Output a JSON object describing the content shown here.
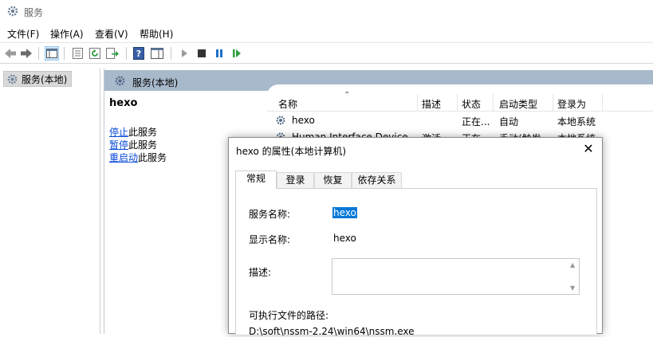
{
  "window": {
    "title": "服务"
  },
  "menu": [
    "文件(F)",
    "操作(A)",
    "查看(V)",
    "帮助(H)"
  ],
  "toolbar": {
    "icons": [
      "back-arrow-icon",
      "forward-arrow-icon",
      "console-tree-icon",
      "properties-sheet-icon",
      "refresh-icon",
      "export-list-icon",
      "help-icon",
      "action-pane-icon",
      "start-service-icon",
      "stop-service-icon",
      "pause-service-icon",
      "restart-service-icon"
    ]
  },
  "tree": {
    "item": "服务(本地)"
  },
  "main": {
    "header": "服务(本地)",
    "service_name": "hexo",
    "actions": [
      {
        "link": "停止",
        "rest": "此服务"
      },
      {
        "link": "暂停",
        "rest": "此服务"
      },
      {
        "link": "重启动",
        "rest": "此服务"
      }
    ]
  },
  "list": {
    "columns": [
      "名称",
      "描述",
      "状态",
      "启动类型",
      "登录为"
    ],
    "rows": [
      {
        "name": "hexo",
        "desc": "",
        "status": "正在...",
        "startup": "自动",
        "logon": "本地系统"
      },
      {
        "name": "Human Interface Device ...",
        "desc": "激活...",
        "status": "正在...",
        "startup": "手动(触发...",
        "logon": "本地系统"
      }
    ]
  },
  "dialog": {
    "title": "hexo 的属性(本地计算机)",
    "tabs": [
      "常规",
      "登录",
      "恢复",
      "依存关系"
    ],
    "service_name_label": "服务名称:",
    "service_name_value": "hexo",
    "display_name_label": "显示名称:",
    "display_name_value": "hexo",
    "desc_label": "描述:",
    "path_label": "可执行文件的路径:",
    "path_value": "D:\\soft\\nssm-2.24\\win64\\nssm.exe"
  },
  "colors": {
    "selection": "#0078d7",
    "link": "#0a4ad8",
    "pane_header": "#a9b9cc"
  }
}
